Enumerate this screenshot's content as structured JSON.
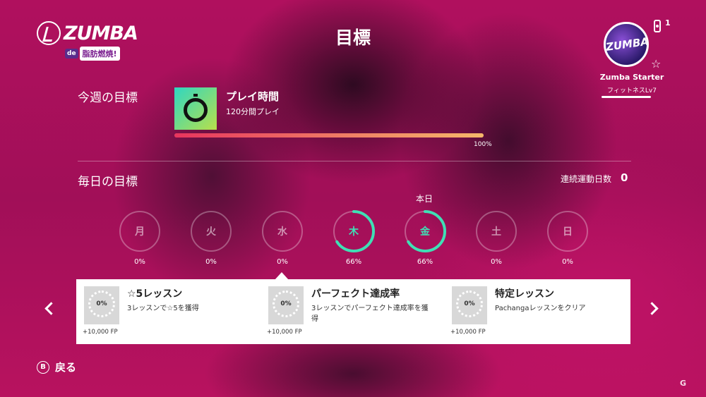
{
  "header": {
    "logo_text": "ZUMBA",
    "logo_sub_de": "de",
    "logo_sub_jp": "脂肪燃焼!",
    "title": "目標"
  },
  "profile": {
    "badge_text": "ZUMBA",
    "player_number": "1",
    "name": "Zumba Starter",
    "level": "フィットネスLv7"
  },
  "weekly": {
    "heading": "今週の目標",
    "goal_title": "プレイ時間",
    "goal_desc": "120分間プレイ",
    "progress": 100,
    "progress_label": "100%",
    "icon": "stopwatch-icon"
  },
  "daily": {
    "heading": "毎日の目標",
    "streak_label": "連続運動日数",
    "streak_value": "0",
    "today_label": "本日",
    "days": [
      {
        "name": "月",
        "progress": 0,
        "label": "0%"
      },
      {
        "name": "火",
        "progress": 0,
        "label": "0%"
      },
      {
        "name": "水",
        "progress": 0,
        "label": "0%"
      },
      {
        "name": "木",
        "progress": 66,
        "label": "66%"
      },
      {
        "name": "金",
        "progress": 66,
        "label": "66%"
      },
      {
        "name": "土",
        "progress": 0,
        "label": "0%"
      },
      {
        "name": "日",
        "progress": 0,
        "label": "0%"
      }
    ],
    "selected_day_index": 2,
    "today_index": 4
  },
  "cards": [
    {
      "title": "☆5レッスン",
      "desc": "3レッスンで☆5を獲得",
      "pct": "0%",
      "reward": "+10,000 FP"
    },
    {
      "title": "パーフェクト達成率",
      "desc": "3レッスンでパーフェクト達成率を獲得",
      "pct": "0%",
      "reward": "+10,000 FP"
    },
    {
      "title": "特定レッスン",
      "desc": "Pachangaレッスンをクリア",
      "pct": "0%",
      "reward": "+10,000 FP"
    }
  ],
  "footer": {
    "back_button_key": "B",
    "back_label": "戻る"
  },
  "colors": {
    "background": "#b0105e",
    "ring_progress": "#3fe0b5",
    "ring_track": "rgba(255,255,255,0.3)",
    "bar_start": "#e8355e",
    "bar_end": "#f5b86a"
  },
  "watermark": "G"
}
